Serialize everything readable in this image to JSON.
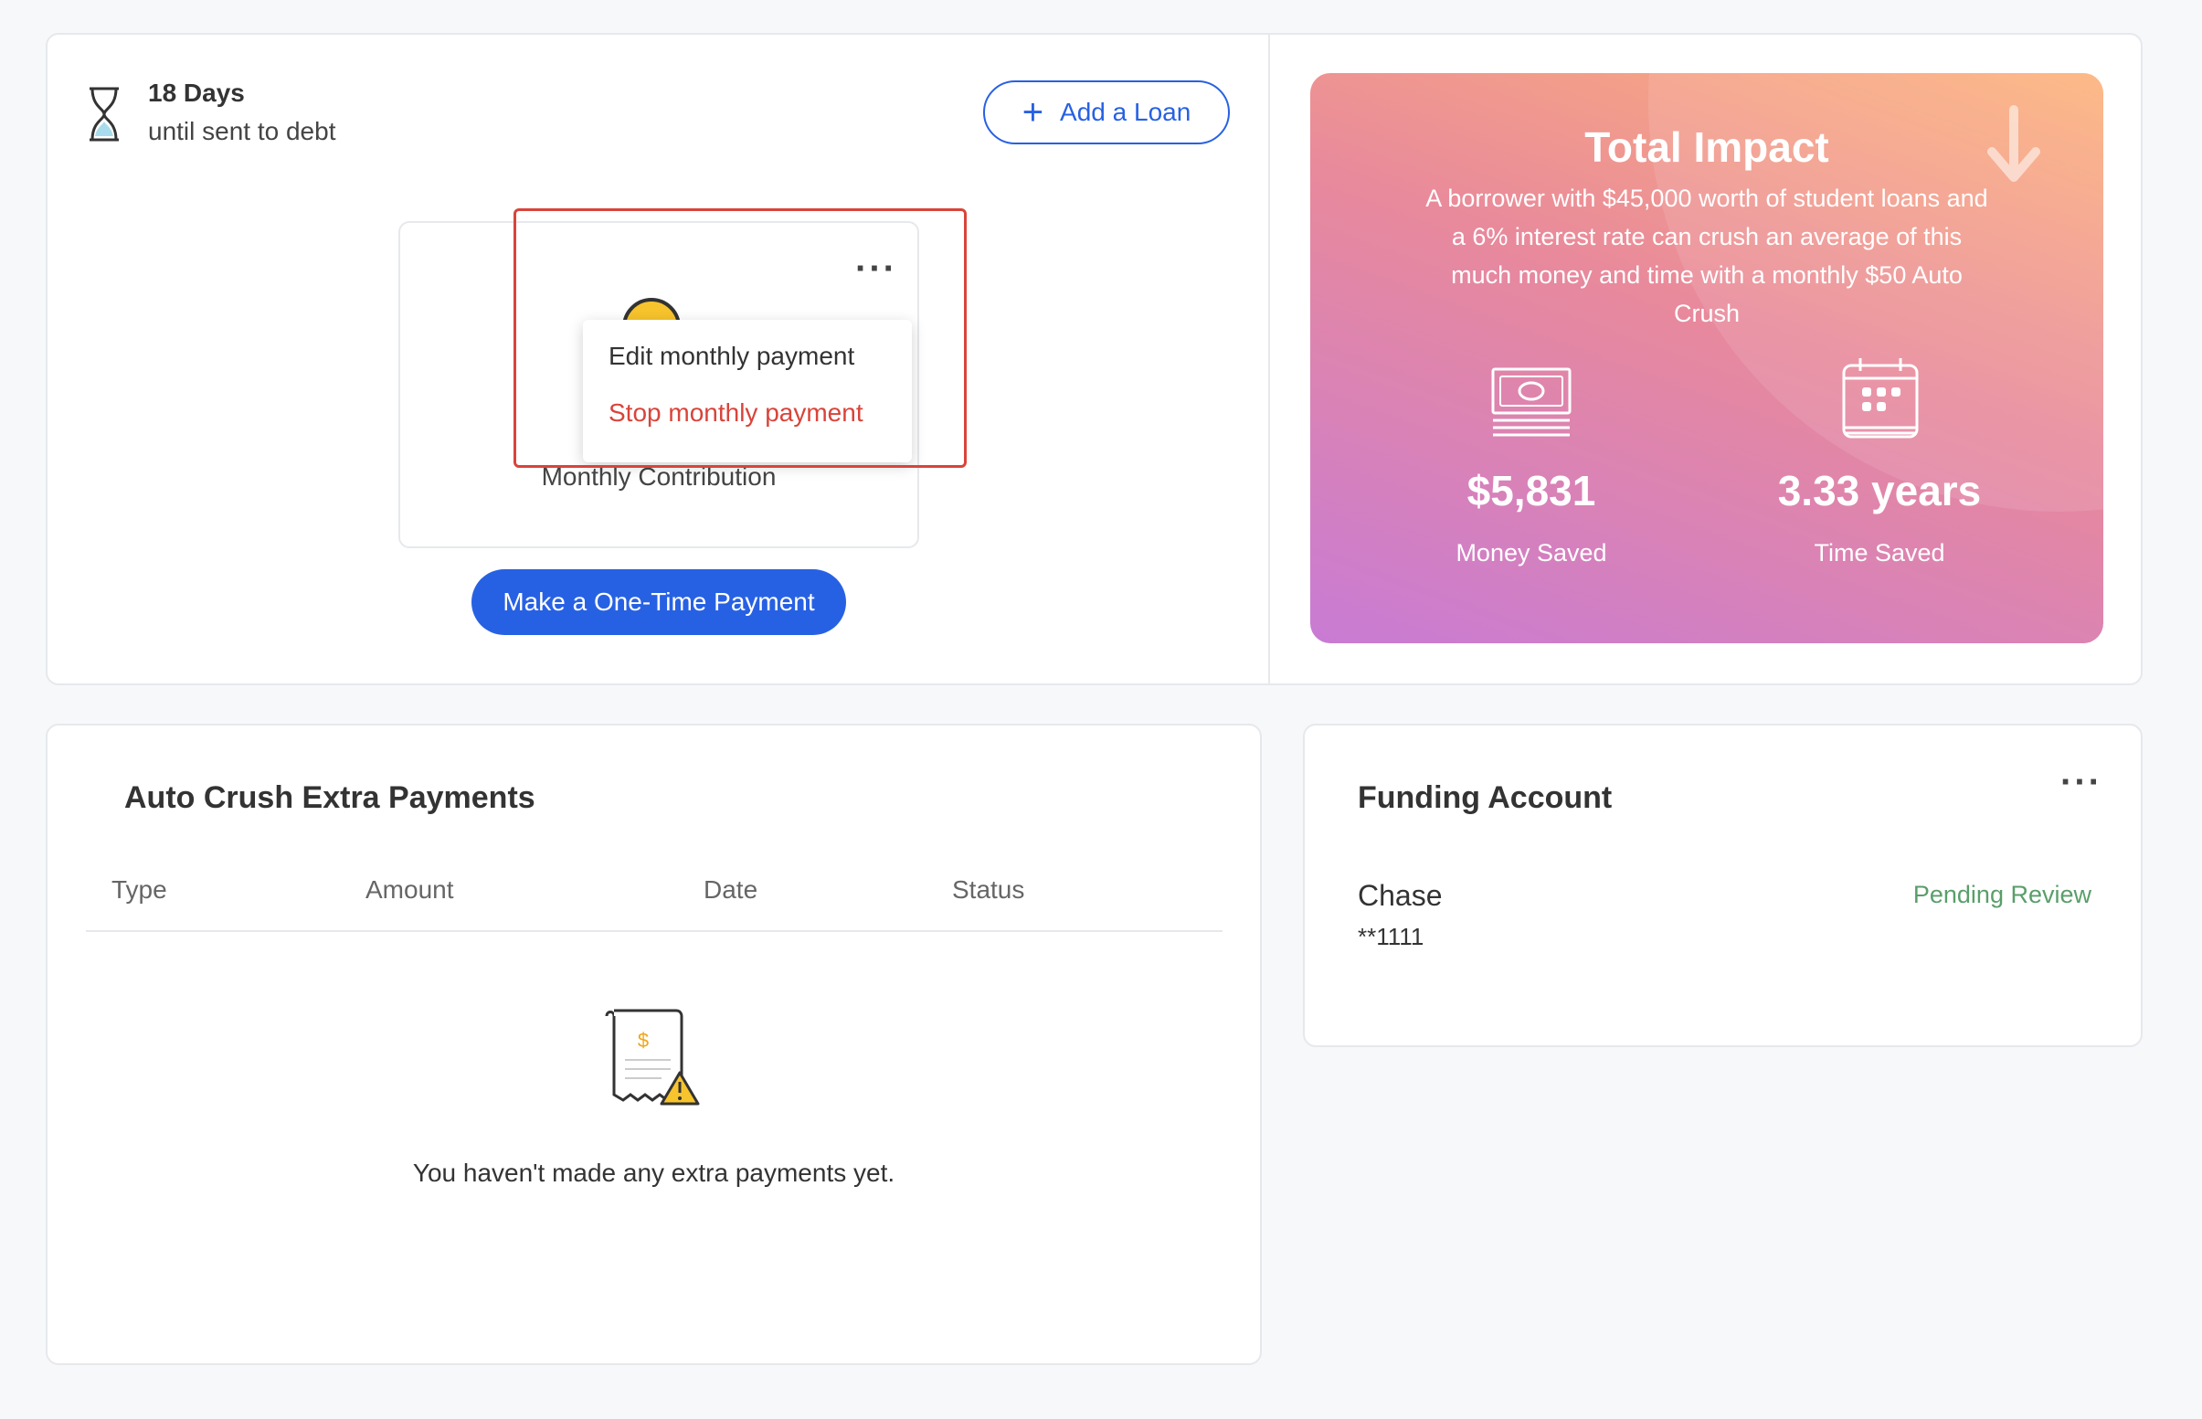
{
  "header": {
    "days_title": "18 Days",
    "days_sub": "until sent to debt",
    "add_loan_label": "Add a Loan"
  },
  "contribution": {
    "label": "Monthly Contribution",
    "menu": {
      "edit_label": "Edit monthly payment",
      "stop_label": "Stop monthly payment"
    },
    "one_time_label": "Make a One-Time Payment"
  },
  "impact": {
    "title": "Total Impact",
    "description": "A borrower with $45,000 worth of student loans and a 6% interest rate can crush an average of this much money and time with a monthly $50 Auto Crush",
    "money_value": "$5,831",
    "money_label": "Money Saved",
    "time_value": "3.33 years",
    "time_label": "Time Saved",
    "colors": {
      "gradient_top": "#fdb27a",
      "gradient_mid": "#e8899c",
      "gradient_bottom": "#c87bd4"
    }
  },
  "payments": {
    "title": "Auto Crush Extra Payments",
    "columns": [
      "Type",
      "Amount",
      "Date",
      "Status"
    ],
    "empty_text": "You haven't made any extra payments yet."
  },
  "funding": {
    "title": "Funding Account",
    "bank_name": "Chase",
    "account_mask": "**1111",
    "status": "Pending Review"
  },
  "icons": [
    "hourglass-icon",
    "plus-icon",
    "more-icon",
    "coin-icon",
    "arrow-down-icon",
    "money-icon",
    "calendar-icon",
    "receipt-icon"
  ],
  "colors": {
    "primary": "#2761e3",
    "danger": "#d9443a",
    "success": "#5a9e6a"
  }
}
